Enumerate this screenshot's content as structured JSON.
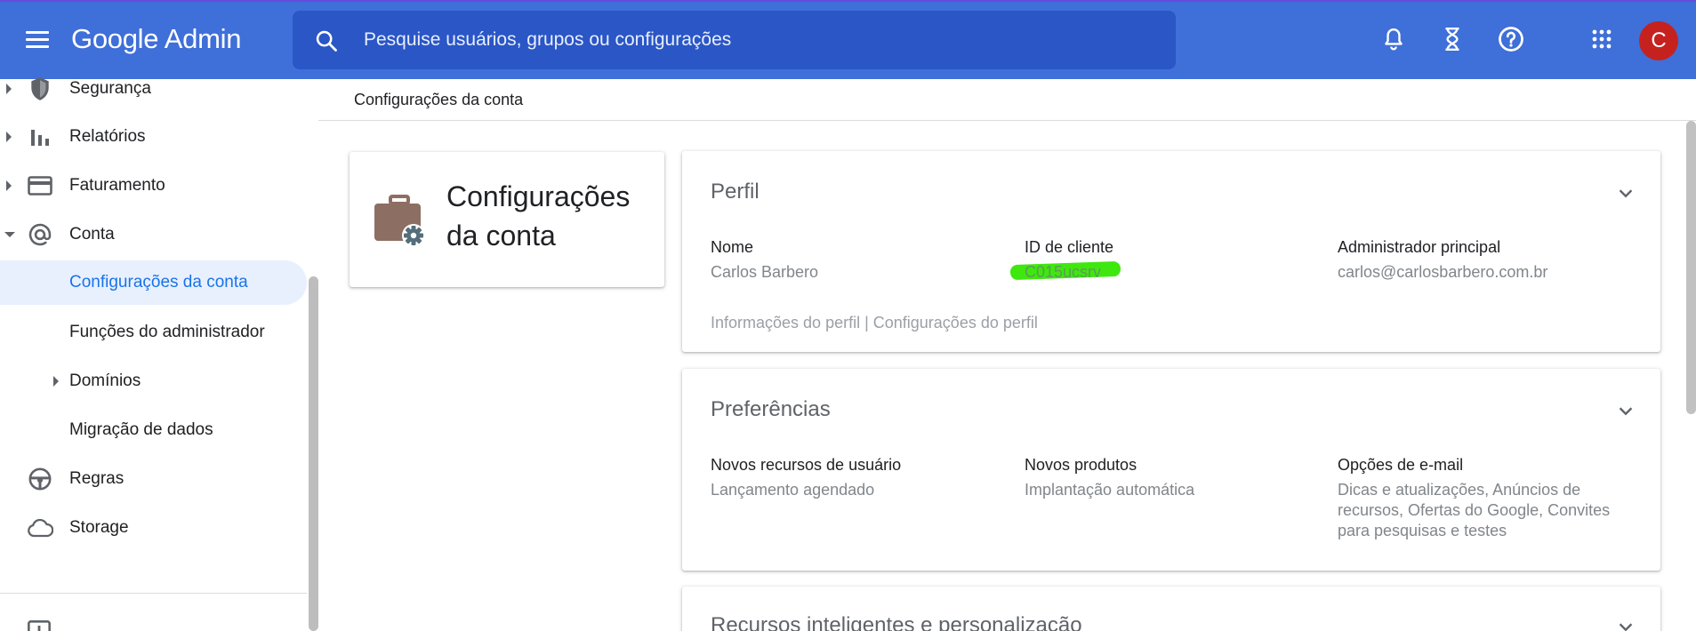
{
  "header": {
    "brand": "Google Admin",
    "search_placeholder": "Pesquise usuários, grupos ou configurações",
    "avatar_letter": "C",
    "avatar_color": "#c5221f",
    "icons": [
      "menu-icon",
      "search-icon",
      "bell-icon",
      "hourglass-icon",
      "help-icon",
      "apps-grid-icon"
    ]
  },
  "sidebar": {
    "items": [
      {
        "label": "Segurança",
        "icon": "shield-icon"
      },
      {
        "label": "Relatórios",
        "icon": "bar-chart-icon"
      },
      {
        "label": "Faturamento",
        "icon": "credit-card-icon"
      },
      {
        "label": "Conta",
        "icon": "at-sign-icon"
      },
      {
        "label": "Configurações da conta"
      },
      {
        "label": "Funções do administrador"
      },
      {
        "label": "Domínios"
      },
      {
        "label": "Migração de dados"
      },
      {
        "label": "Regras",
        "icon": "steering-wheel-icon"
      },
      {
        "label": "Storage",
        "icon": "cloud-icon"
      }
    ]
  },
  "breadcrumb": "Configurações da conta",
  "title_card": {
    "line1": "Configurações",
    "line2": "da conta"
  },
  "profile": {
    "title": "Perfil",
    "name_label": "Nome",
    "name_value": "Carlos Barbero",
    "id_label": "ID de cliente",
    "id_value": "C015ucsrv",
    "admin_label": "Administrador principal",
    "admin_value": "carlos@carlosbarbero.com.br",
    "links": "Informações do perfil | Configurações do perfil"
  },
  "preferences": {
    "title": "Preferências",
    "col1_label": "Novos recursos de usuário",
    "col1_value": "Lançamento agendado",
    "col2_label": "Novos produtos",
    "col2_value": "Implantação automática",
    "col3_label": "Opções de e-mail",
    "col3_value": "Dicas e atualizações, Anúncios de recursos, Ofertas do Google, Convites para pesquisas e testes"
  },
  "smart": {
    "title": "Recursos inteligentes e personalização"
  }
}
